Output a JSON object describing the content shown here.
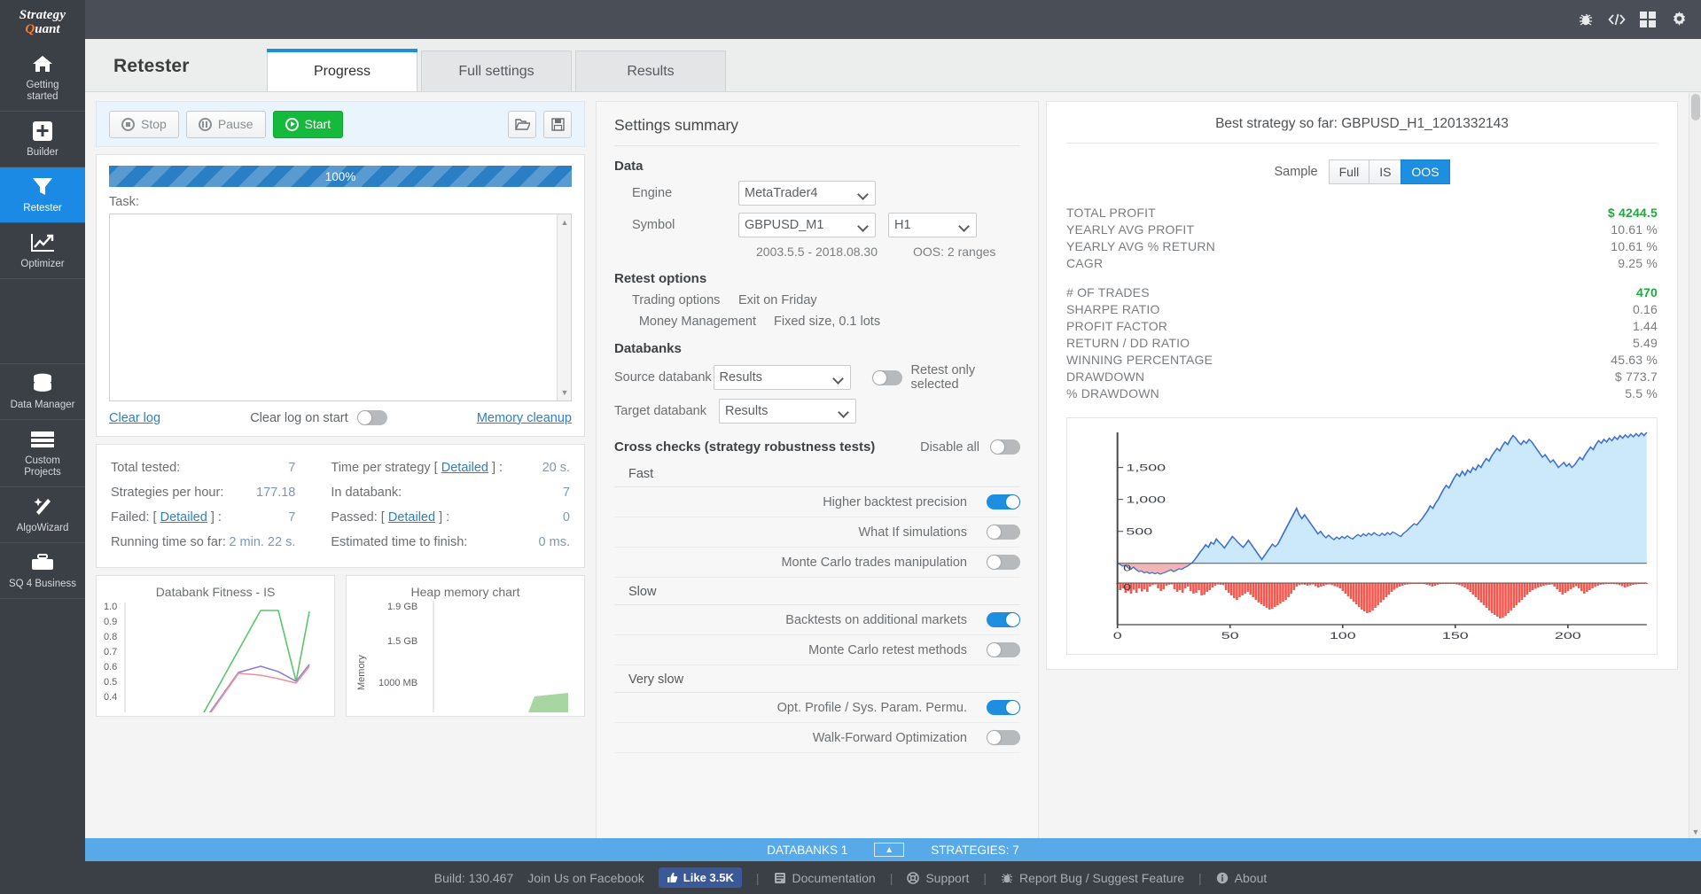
{
  "sidebar": {
    "logo_line1": "Strategy",
    "logo_line2": "uant",
    "items": [
      {
        "label": "Getting\nstarted",
        "icon": "home-icon"
      },
      {
        "label": "Builder",
        "icon": "plus-box-icon"
      },
      {
        "label": "Retester",
        "icon": "funnel-icon"
      },
      {
        "label": "Optimizer",
        "icon": "line-chart-icon"
      },
      {
        "label": "Data Manager",
        "icon": "database-icon"
      },
      {
        "label": "Custom\nProjects",
        "icon": "list-icon"
      },
      {
        "label": "AlgoWizard",
        "icon": "wand-icon"
      },
      {
        "label": "SQ 4 Business",
        "icon": "briefcase-icon"
      }
    ]
  },
  "topbar": {
    "buttons": [
      "bug-icon",
      "code-icon",
      "grid-icon",
      "gear-icon"
    ]
  },
  "header": {
    "page_title": "Retester",
    "tabs": [
      {
        "label": "Progress",
        "active": true
      },
      {
        "label": "Full settings",
        "active": false
      },
      {
        "label": "Results",
        "active": false
      }
    ]
  },
  "toolbar": {
    "stop_label": "Stop",
    "pause_label": "Pause",
    "start_label": "Start",
    "open_icon": "folder-open-icon",
    "save_icon": "floppy-save-icon"
  },
  "log": {
    "progress_text": "100%",
    "progress_percent": 100,
    "task_label": "Task:",
    "task_value": "",
    "clear_log_link": "Clear log",
    "clear_on_start_label": "Clear log on start",
    "clear_on_start_on": false,
    "memory_cleanup_link": "Memory cleanup"
  },
  "stats": [
    {
      "label": "Total tested:",
      "value": "7",
      "label2": "Time per strategy [ Detailed ] :",
      "value2": "20 s."
    },
    {
      "label": "Strategies per hour:",
      "value": "177.18",
      "label2": "In databank:",
      "value2": "7"
    },
    {
      "label": "Failed: [ Detailed ] :",
      "value": "7",
      "label2": "Passed: [ Detailed ] :",
      "value2": "0"
    },
    {
      "label": "Running time so far:",
      "value": "2 min. 22 s.",
      "label2": "Estimated time to finish:",
      "value2": "0 ms."
    }
  ],
  "minicharts": [
    {
      "title": "Databank Fitness - IS",
      "yticks": [
        "1.0",
        "0.9",
        "0.8",
        "0.7",
        "0.6",
        "0.5",
        "0.4"
      ]
    },
    {
      "title": "Heap memory chart",
      "axis_label": "Memory",
      "yticks": [
        "1.9 GB",
        "1.5 GB",
        "1000 MB"
      ]
    }
  ],
  "settings": {
    "title": "Settings summary",
    "data_group": "Data",
    "engine_label": "Engine",
    "engine_value": "MetaTrader4",
    "symbol_label": "Symbol",
    "symbol_value": "GBPUSD_M1",
    "timeframe_value": "H1",
    "date_range": "2003.5.5 - 2018.08.30",
    "oos_text": "OOS: 2 ranges",
    "retest_group": "Retest options",
    "trading_options_label": "Trading options",
    "trading_options_value": "Exit on Friday",
    "money_management_label": "Money Management",
    "money_management_value": "Fixed size, 0.1 lots",
    "databanks_group": "Databanks",
    "source_databank_label": "Source databank",
    "source_databank_value": "Results",
    "target_databank_label": "Target databank",
    "target_databank_value": "Results",
    "retest_only_selected_label": "Retest only selected",
    "retest_only_selected_on": false,
    "cross_checks_title": "Cross checks (strategy robustness tests)",
    "disable_all_label": "Disable all",
    "disable_all_on": false,
    "cross_checks": [
      {
        "group": "Fast",
        "rows": [
          {
            "name": "Higher backtest precision",
            "on": true
          },
          {
            "name": "What If simulations",
            "on": false
          },
          {
            "name": "Monte Carlo trades manipulation",
            "on": false
          }
        ]
      },
      {
        "group": "Slow",
        "rows": [
          {
            "name": "Backtests on additional markets",
            "on": true
          },
          {
            "name": "Monte Carlo retest methods",
            "on": false
          }
        ]
      },
      {
        "group": "Very slow",
        "rows": [
          {
            "name": "Opt. Profile / Sys. Param. Permu.",
            "on": true
          },
          {
            "name": "Walk-Forward Optimization",
            "on": false
          }
        ]
      }
    ]
  },
  "results": {
    "best_title": "Best strategy so far: GBPUSD_H1_1201332143",
    "sample_label": "Sample",
    "sample_options": [
      {
        "label": "Full",
        "on": false
      },
      {
        "label": "IS",
        "on": false
      },
      {
        "label": "OOS",
        "on": true
      }
    ],
    "metrics_a": [
      {
        "key": "TOTAL PROFIT",
        "value": "$ 4244.5",
        "green": true
      },
      {
        "key": "YEARLY AVG PROFIT",
        "value": "10.61 %",
        "green": false
      },
      {
        "key": "YEARLY AVG % RETURN",
        "value": "10.61 %",
        "green": false
      },
      {
        "key": "CAGR",
        "value": "9.25 %",
        "green": false
      }
    ],
    "metrics_b": [
      {
        "key": "# OF TRADES",
        "value": "470",
        "green": true
      },
      {
        "key": "SHARPE RATIO",
        "value": "0.16",
        "green": false
      },
      {
        "key": "PROFIT FACTOR",
        "value": "1.44",
        "green": false
      },
      {
        "key": "RETURN / DD RATIO",
        "value": "5.49",
        "green": false
      },
      {
        "key": "WINNING PERCENTAGE",
        "value": "45.63 %",
        "green": false
      },
      {
        "key": "DRAWDOWN",
        "value": "$ 773.7",
        "green": false
      },
      {
        "key": "% DRAWDOWN",
        "value": "5.5 %",
        "green": false
      }
    ]
  },
  "chart_data": {
    "type": "area",
    "title": "",
    "xlabel": "",
    "ylabel": "",
    "xlim": [
      0,
      235
    ],
    "ylim": [
      -170,
      2050
    ],
    "yticks": [
      500,
      1000,
      1500
    ],
    "ytick_labels": [
      "500",
      "1,000",
      "1,500"
    ],
    "xticks": [
      0,
      50,
      100,
      150,
      200
    ],
    "xtick_labels": [
      "0",
      "50",
      "100",
      "150",
      "200"
    ],
    "zero_label": "0",
    "series": [
      {
        "name": "Equity",
        "color": "#3f6fd1",
        "fill_positive": "#cbe9fb",
        "fill_negative": "#f0b6b6",
        "values": [
          0,
          -20,
          -45,
          -30,
          -70,
          -95,
          -60,
          -100,
          -130,
          -120,
          -150,
          -135,
          -160,
          -145,
          -165,
          -150,
          -170,
          -155,
          -140,
          -120,
          -100,
          -130,
          -110,
          -85,
          -95,
          -70,
          -50,
          -20,
          10,
          60,
          120,
          180,
          230,
          290,
          250,
          330,
          300,
          380,
          330,
          290,
          240,
          300,
          360,
          420,
          380,
          330,
          290,
          250,
          300,
          360,
          300,
          240,
          180,
          120,
          60,
          120,
          180,
          240,
          300,
          260,
          300,
          380,
          460,
          540,
          620,
          700,
          780,
          860,
          760,
          700,
          760,
          700,
          640,
          580,
          520,
          460,
          500,
          440,
          400,
          440,
          400,
          370,
          410,
          380,
          420,
          390,
          430,
          400,
          380,
          420,
          450,
          420,
          460,
          430,
          470,
          440,
          480,
          450,
          430,
          470,
          440,
          480,
          450,
          490,
          470,
          440,
          420,
          470,
          500,
          540,
          580,
          620,
          600,
          650,
          700,
          760,
          820,
          900,
          860,
          940,
          1000,
          1080,
          1160,
          1220,
          1180,
          1260,
          1340,
          1400,
          1360,
          1440,
          1380,
          1460,
          1420,
          1500,
          1460,
          1540,
          1500,
          1580,
          1640,
          1600,
          1680,
          1740,
          1800,
          1760,
          1840,
          1900,
          1860,
          1940,
          2000,
          1960,
          1900,
          1860,
          1920,
          1880,
          1940,
          1900,
          1840,
          1780,
          1720,
          1660,
          1700,
          1640,
          1580,
          1620,
          1560,
          1500,
          1540,
          1580,
          1520,
          1560,
          1500,
          1540,
          1600,
          1660,
          1620,
          1700,
          1760,
          1820,
          1780,
          1860,
          1920,
          1880,
          1940,
          1900,
          1960,
          1920,
          1980,
          1940,
          2000,
          1960,
          2010,
          1970,
          2020,
          1980,
          2030,
          1990,
          2040,
          2000,
          2050
        ]
      },
      {
        "name": "Drawdown",
        "color": "#f4584f",
        "type": "bar",
        "values": [
          -5,
          -40,
          -30,
          -55,
          -45,
          -60,
          -38,
          -55,
          -30,
          -48,
          -35,
          -50,
          -20,
          -12,
          -8,
          -30,
          -45,
          -35,
          -15,
          -10,
          -8,
          -35,
          -50,
          -40,
          -55,
          -30,
          -20,
          -45,
          -60,
          -55,
          -40,
          -70,
          -65,
          -50,
          -40,
          -25,
          -15,
          -8,
          -10,
          -12,
          -40,
          -55,
          -70,
          -85,
          -95,
          -80,
          -70,
          -60,
          -50,
          -65,
          -80,
          -95,
          -110,
          -120,
          -130,
          -140,
          -150,
          -145,
          -135,
          -125,
          -115,
          -105,
          -95,
          -80,
          -60,
          -40,
          -20,
          -12,
          -8,
          -10,
          -15,
          -12,
          -8,
          -18,
          -25,
          -20,
          -15,
          -10,
          -8,
          -12,
          -18,
          -22,
          -30,
          -45,
          -60,
          -75,
          -90,
          -105,
          -120,
          -135,
          -150,
          -160,
          -170,
          -165,
          -155,
          -140,
          -125,
          -110,
          -95,
          -80,
          -65,
          -50,
          -38,
          -28,
          -20,
          -15,
          -10,
          -8,
          -6,
          -4,
          -3,
          -2,
          -4,
          -6,
          -10,
          -14,
          -20,
          -15,
          -10,
          -6,
          -4,
          -2,
          -1,
          -2,
          -4,
          -8,
          -12,
          -18,
          -25,
          -35,
          -50,
          -65,
          -80,
          -95,
          -110,
          -125,
          -140,
          -155,
          -170,
          -180,
          -190,
          -200,
          -195,
          -185,
          -170,
          -155,
          -140,
          -125,
          -110,
          -95,
          -80,
          -65,
          -50,
          -40,
          -32,
          -25,
          -20,
          -15,
          -12,
          -10,
          -8,
          -20,
          -35,
          -50,
          -65,
          -55,
          -45,
          -35,
          -25,
          -18,
          -30,
          -45,
          -60,
          -50,
          -40,
          -30,
          -22,
          -15,
          -10,
          -8,
          -6,
          -5,
          -4,
          -6,
          -8,
          -12,
          -18,
          -25,
          -20,
          -15,
          -10,
          -8,
          -6,
          -5,
          -4,
          -3
        ]
      }
    ]
  },
  "statusbar": {
    "databanks_label": "DATABANKS 1",
    "strategies_label": "STRATEGIES: 7",
    "chevron": "chevron-up-icon"
  },
  "footer": {
    "build": "Build: 130.467",
    "facebook": "Join Us on Facebook",
    "like": "Like 3.5K",
    "documentation": "Documentation",
    "support": "Support",
    "report_bug": "Report Bug / Suggest Feature",
    "about": "About"
  }
}
